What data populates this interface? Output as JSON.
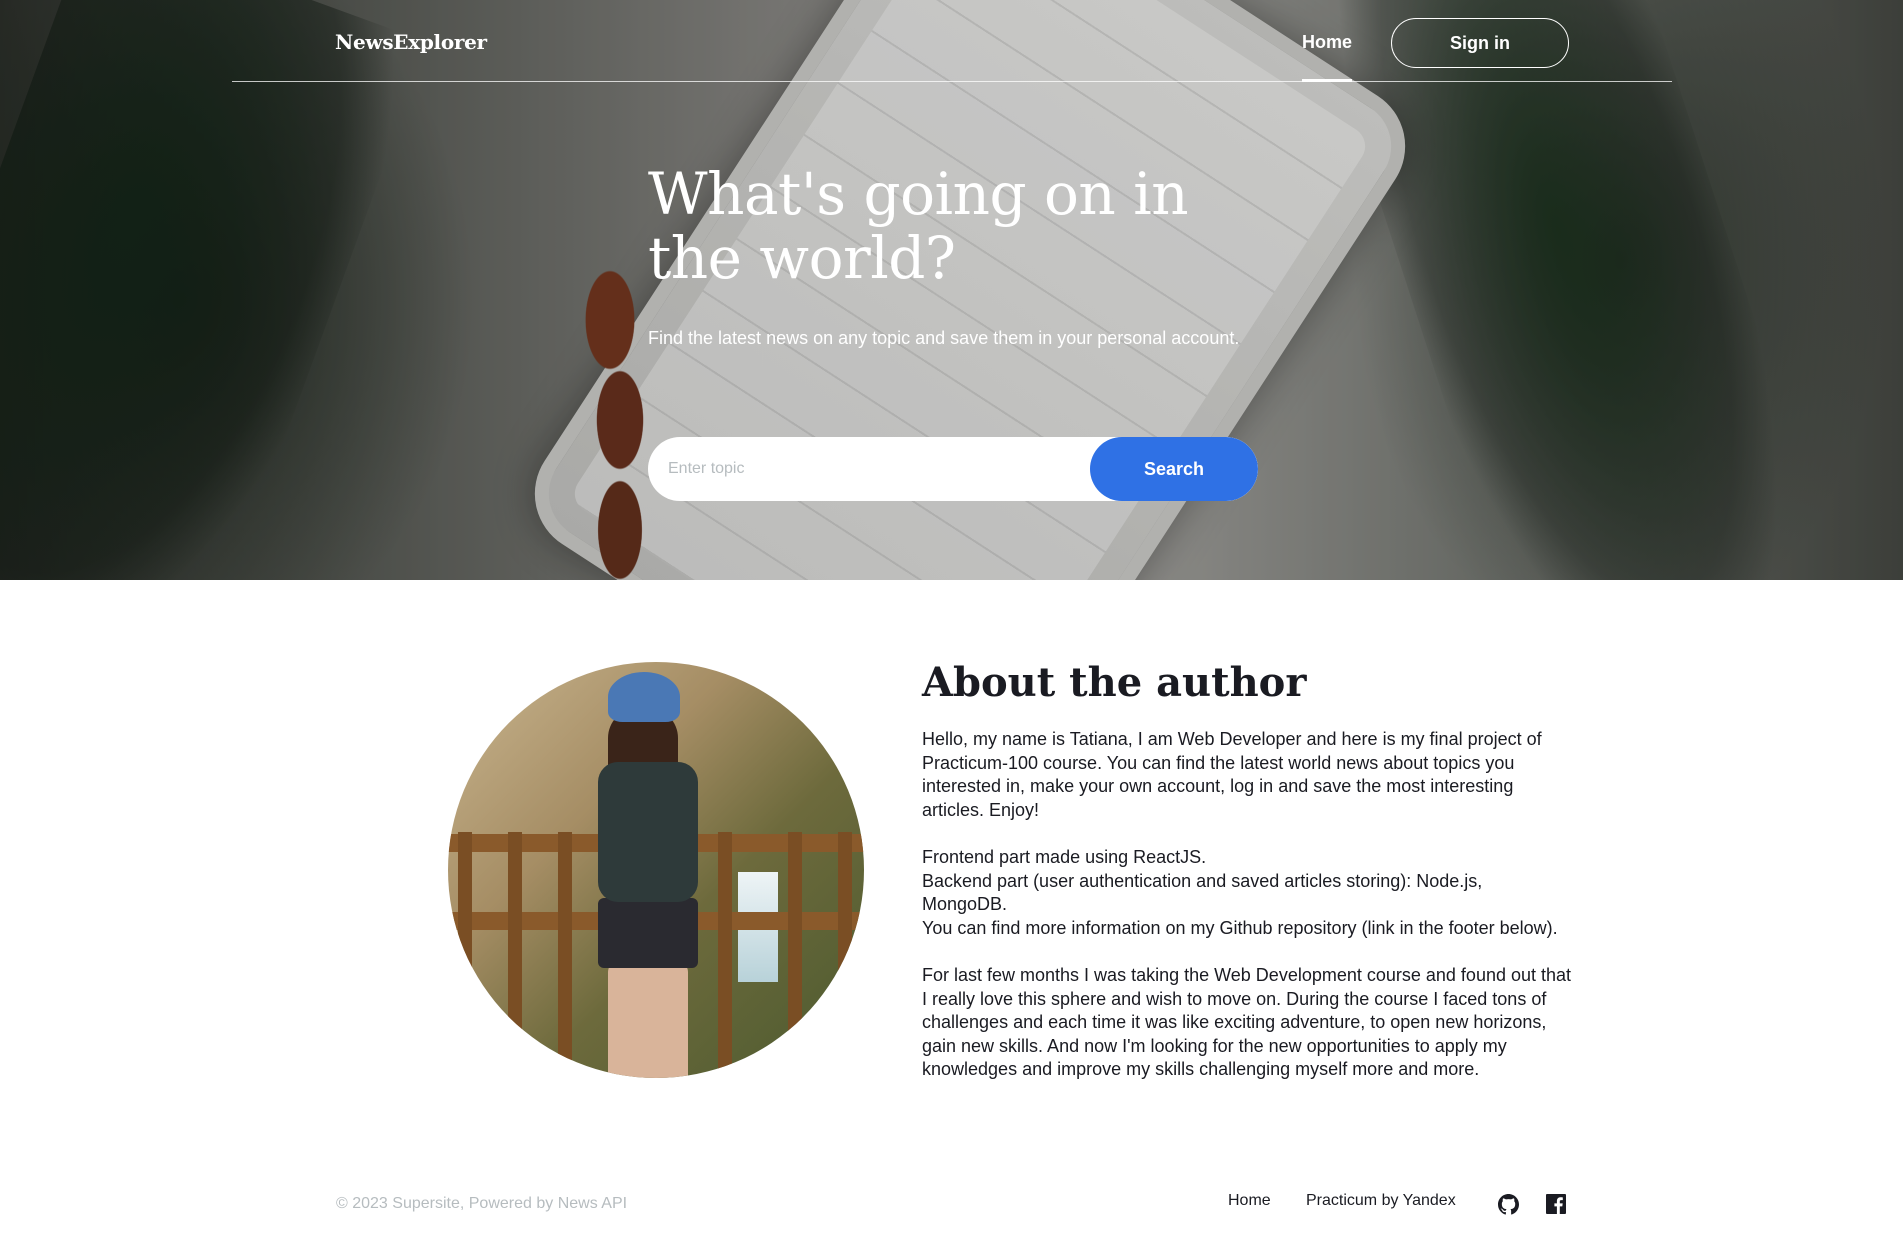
{
  "header": {
    "logo": "NewsExplorer",
    "nav_home": "Home",
    "signin_label": "Sign in"
  },
  "hero": {
    "title": "What's going on in the world?",
    "subtitle": "Find the latest news on any topic and save them in your personal account.",
    "search_placeholder": "Enter topic",
    "search_value": "",
    "search_button": "Search"
  },
  "about": {
    "title": "About the author",
    "paragraphs": [
      "Hello, my name is Tatiana, I am Web Developer and here is my final project of Practicum-100 course. You can find the latest world news about topics you interested in, make your own account, log in and save the most interesting articles. Enjoy!",
      "Frontend part made using ReactJS.",
      "Backend part (user authentication and saved articles storing): Node.js, MongoDB.",
      "You can find more information on my Github repository (link in the footer below).",
      "For last few months I was taking the Web Development course and found out that I really love this sphere and wish to move on. During the course I faced tons of challenges and each time it was like exciting adventure, to open new horizons, gain new skills. And now I'm looking for the new opportunities to apply my knowledges and improve my skills challenging myself more and more."
    ]
  },
  "footer": {
    "copyright": "© 2023 Supersite, Powered by News API",
    "links": [
      "Home",
      "Practicum by Yandex"
    ],
    "social_icons": [
      "github-icon",
      "facebook-icon"
    ]
  },
  "colors": {
    "accent": "#2f71e5",
    "text": "#1a1b22",
    "muted": "#b6bcbf"
  }
}
